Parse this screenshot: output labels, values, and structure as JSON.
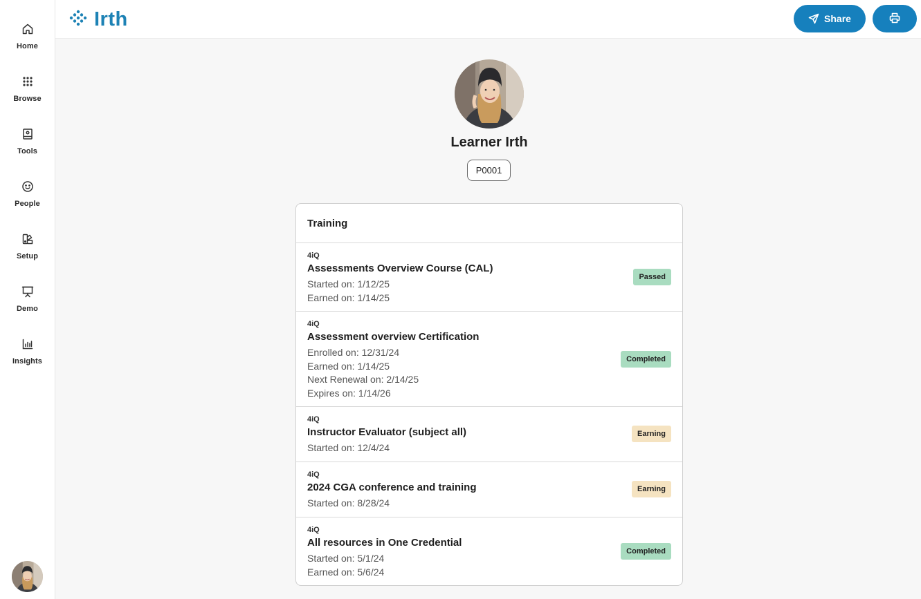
{
  "sidebar": {
    "items": [
      {
        "label": "Home",
        "icon": "home-icon"
      },
      {
        "label": "Browse",
        "icon": "grid-icon"
      },
      {
        "label": "Tools",
        "icon": "tools-icon"
      },
      {
        "label": "People",
        "icon": "smile-icon"
      },
      {
        "label": "Setup",
        "icon": "setup-icon"
      },
      {
        "label": "Demo",
        "icon": "presentation-icon"
      },
      {
        "label": "Insights",
        "icon": "bar-chart-icon"
      }
    ]
  },
  "header": {
    "brand": "Irth",
    "share_label": "Share",
    "print_icon": "print-icon"
  },
  "profile": {
    "name": "Learner Irth",
    "id": "P0001"
  },
  "training": {
    "title": "Training",
    "items": [
      {
        "provider": "4iQ",
        "title": "Assessments Overview Course (CAL)",
        "details": [
          "Started on: 1/12/25",
          "Earned on: 1/14/25"
        ],
        "status": "Passed",
        "status_color": "#a9dcc0"
      },
      {
        "provider": "4iQ",
        "title": "Assessment overview Certification",
        "details": [
          "Enrolled on: 12/31/24",
          "Earned on: 1/14/25",
          "Next Renewal on: 2/14/25",
          "Expires on: 1/14/26"
        ],
        "status": "Completed",
        "status_color": "#a9dcc0"
      },
      {
        "provider": "4iQ",
        "title": "Instructor Evaluator (subject all)",
        "details": [
          "Started on: 12/4/24"
        ],
        "status": "Earning",
        "status_color": "#f5e3c1"
      },
      {
        "provider": "4iQ",
        "title": "2024 CGA conference and training",
        "details": [
          "Started on: 8/28/24"
        ],
        "status": "Earning",
        "status_color": "#f5e3c1"
      },
      {
        "provider": "4iQ",
        "title": "All resources in One Credential",
        "details": [
          "Started on: 5/1/24",
          "Earned on: 5/6/24"
        ],
        "status": "Completed",
        "status_color": "#a9dcc0"
      }
    ]
  },
  "colors": {
    "brand": "#1d82b5",
    "button": "#1680bd",
    "status_done": "#a9dcc0",
    "status_earning": "#f5e3c1"
  }
}
